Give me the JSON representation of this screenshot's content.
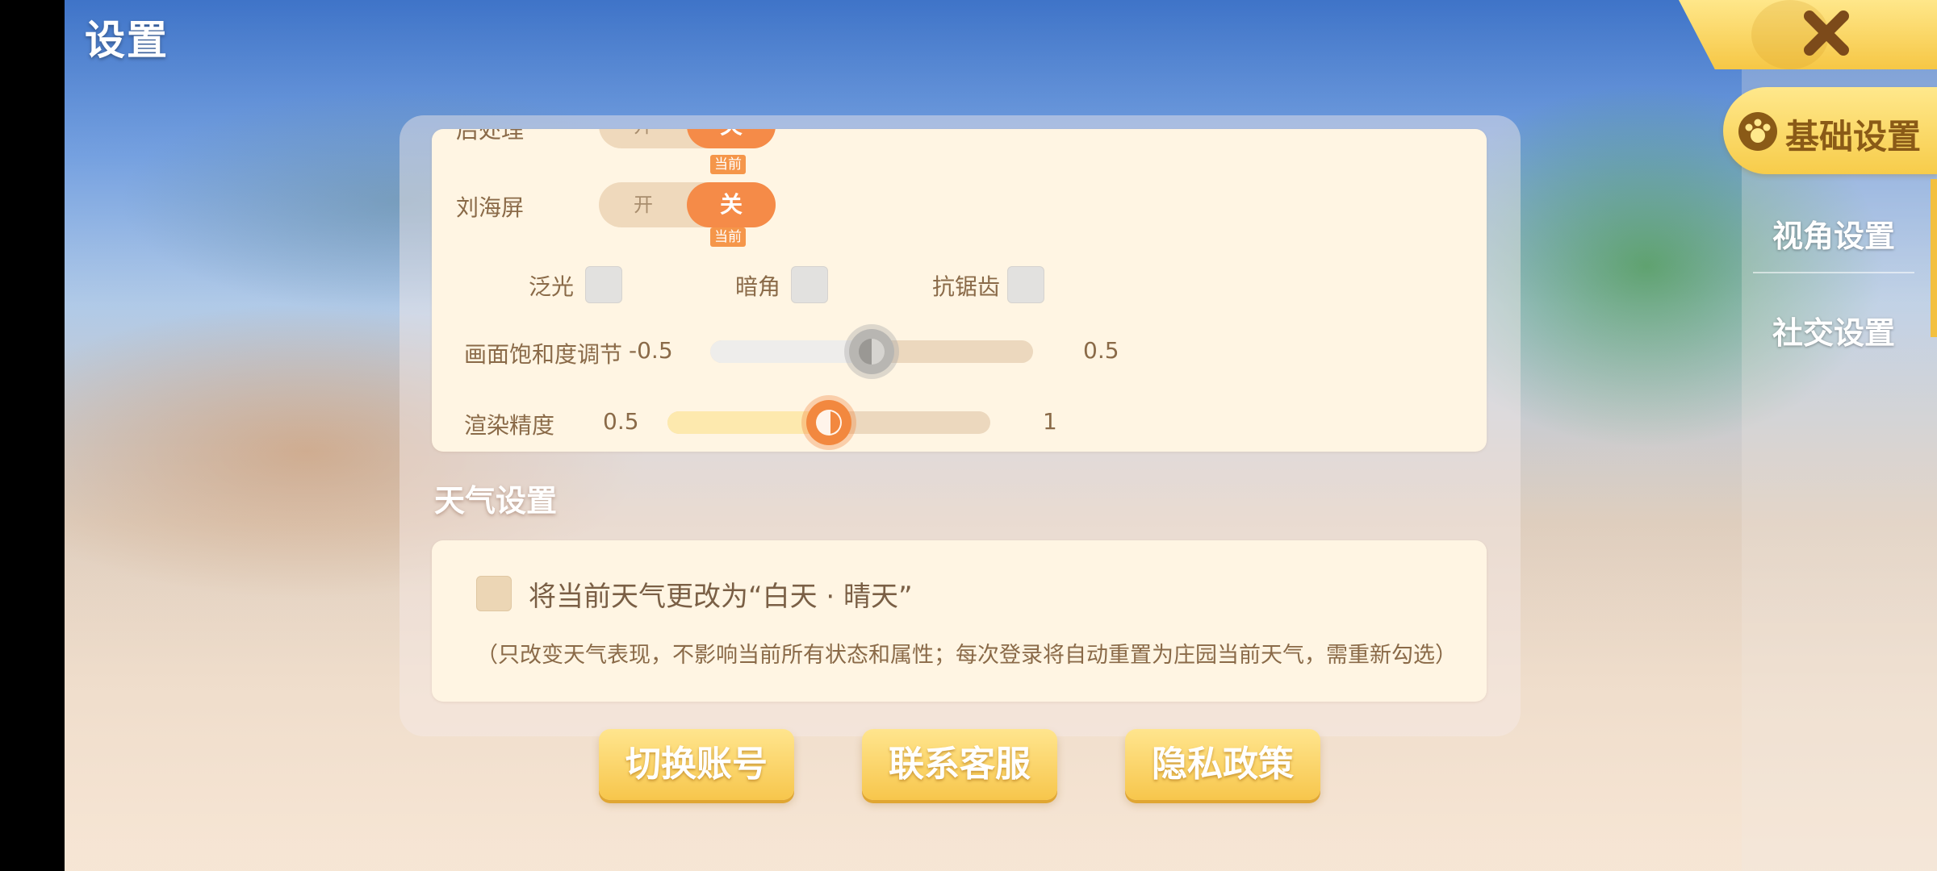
{
  "header": {
    "title": "设置"
  },
  "sidebar": {
    "active": "基础设置",
    "items": [
      {
        "label": "基础设置"
      },
      {
        "label": "视角设置"
      },
      {
        "label": "社交设置"
      }
    ]
  },
  "render_settings": {
    "post_processing": {
      "label": "后处理",
      "on_label": "开",
      "off_label": "关",
      "badge": "当前",
      "state": "关"
    },
    "notch_screen": {
      "label": "刘海屏",
      "on_label": "开",
      "off_label": "关",
      "badge": "当前",
      "state": "关"
    },
    "checkboxes": [
      {
        "label": "泛光",
        "checked": false
      },
      {
        "label": "暗角",
        "checked": false
      },
      {
        "label": "抗锯齿",
        "checked": false
      }
    ],
    "saturation": {
      "label": "画面饱和度调节",
      "min_label": "-0.5",
      "max_label": "0.5",
      "value": 0.0
    },
    "render_precision": {
      "label": "渲染精度",
      "min_label": "0.5",
      "max_label": "1",
      "value": 0.75
    }
  },
  "weather": {
    "section_title": "天气设置",
    "checkbox_label": "将当前天气更改为“白天 · 晴天”",
    "checked": false,
    "note": "（只改变天气表现，不影响当前所有状态和属性；每次登录将自动重置为庄园当前天气，需重新勾选）"
  },
  "buttons": {
    "switch_account": "切换账号",
    "contact_support": "联系客服",
    "privacy_policy": "隐私政策"
  },
  "colors": {
    "accent_orange": "#f58b48",
    "accent_yellow": "#f7c64c",
    "card_bg": "#fff5e3",
    "label_brown": "#8a6a48"
  }
}
